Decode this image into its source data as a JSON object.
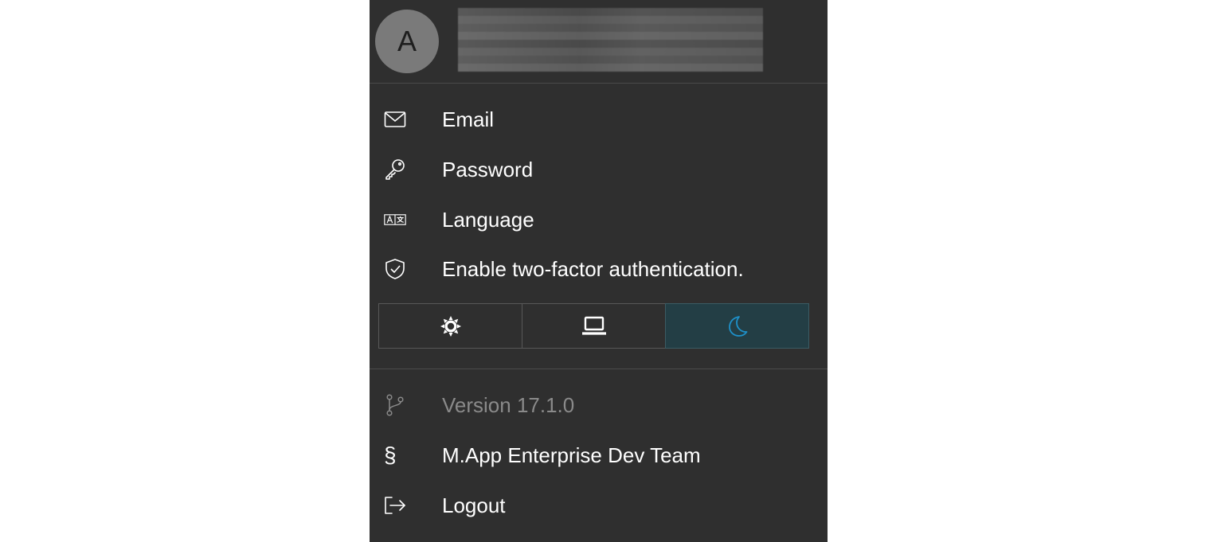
{
  "user": {
    "avatar_initial": "A"
  },
  "menu": {
    "items": [
      {
        "label": "Email",
        "icon": "mail-icon"
      },
      {
        "label": "Password",
        "icon": "key-icon"
      },
      {
        "label": "Language",
        "icon": "translate-icon"
      },
      {
        "label": "Enable two-factor authentication.",
        "icon": "shield-check-icon"
      }
    ]
  },
  "theme": {
    "options": [
      "light",
      "system",
      "dark"
    ],
    "selected": "dark",
    "accent_color": "#1e90c8"
  },
  "footer": {
    "version": "Version 17.1.0",
    "team": "M.App Enterprise Dev Team",
    "logout": "Logout"
  }
}
